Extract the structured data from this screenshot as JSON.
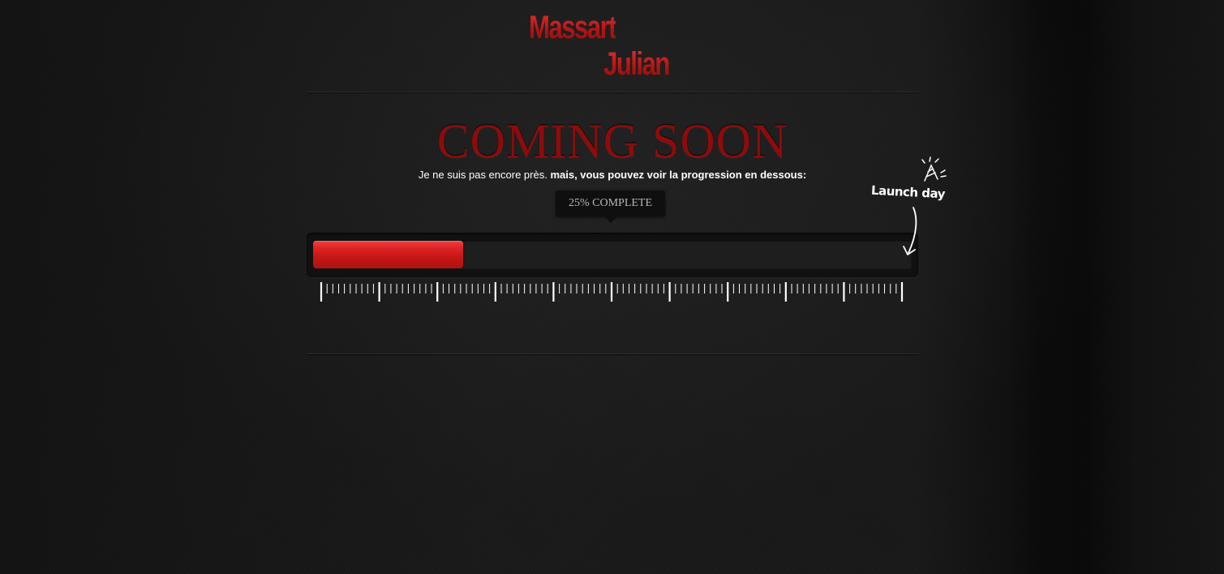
{
  "logo": {
    "line1": "Massart",
    "line2": "Julian"
  },
  "headline": "COMING SOON",
  "subline": {
    "normal": "Je ne suis pas encore près.",
    "strong": "mais, vous pouvez voir la progression en dessous:"
  },
  "progress": {
    "label": "25% COMPLETE",
    "fraction": 0.25
  },
  "launch": {
    "label": "Launch day",
    "icon": "party-hat-icon"
  },
  "colors": {
    "accent": "#c41717",
    "headline": "#8f0b0b",
    "background": "#161616"
  }
}
